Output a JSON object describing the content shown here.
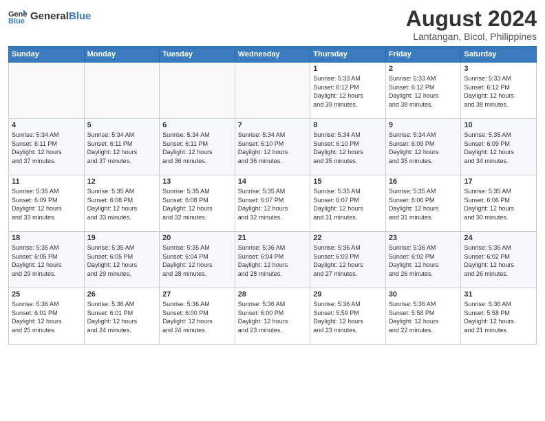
{
  "header": {
    "logo_general": "General",
    "logo_blue": "Blue",
    "title": "August 2024",
    "subtitle": "Lantangan, Bicol, Philippines"
  },
  "days_of_week": [
    "Sunday",
    "Monday",
    "Tuesday",
    "Wednesday",
    "Thursday",
    "Friday",
    "Saturday"
  ],
  "weeks": [
    [
      {
        "day": "",
        "info": ""
      },
      {
        "day": "",
        "info": ""
      },
      {
        "day": "",
        "info": ""
      },
      {
        "day": "",
        "info": ""
      },
      {
        "day": "1",
        "info": "Sunrise: 5:33 AM\nSunset: 6:12 PM\nDaylight: 12 hours\nand 39 minutes."
      },
      {
        "day": "2",
        "info": "Sunrise: 5:33 AM\nSunset: 6:12 PM\nDaylight: 12 hours\nand 38 minutes."
      },
      {
        "day": "3",
        "info": "Sunrise: 5:33 AM\nSunset: 6:12 PM\nDaylight: 12 hours\nand 38 minutes."
      }
    ],
    [
      {
        "day": "4",
        "info": "Sunrise: 5:34 AM\nSunset: 6:11 PM\nDaylight: 12 hours\nand 37 minutes."
      },
      {
        "day": "5",
        "info": "Sunrise: 5:34 AM\nSunset: 6:11 PM\nDaylight: 12 hours\nand 37 minutes."
      },
      {
        "day": "6",
        "info": "Sunrise: 5:34 AM\nSunset: 6:11 PM\nDaylight: 12 hours\nand 36 minutes."
      },
      {
        "day": "7",
        "info": "Sunrise: 5:34 AM\nSunset: 6:10 PM\nDaylight: 12 hours\nand 36 minutes."
      },
      {
        "day": "8",
        "info": "Sunrise: 5:34 AM\nSunset: 6:10 PM\nDaylight: 12 hours\nand 35 minutes."
      },
      {
        "day": "9",
        "info": "Sunrise: 5:34 AM\nSunset: 6:09 PM\nDaylight: 12 hours\nand 35 minutes."
      },
      {
        "day": "10",
        "info": "Sunrise: 5:35 AM\nSunset: 6:09 PM\nDaylight: 12 hours\nand 34 minutes."
      }
    ],
    [
      {
        "day": "11",
        "info": "Sunrise: 5:35 AM\nSunset: 6:09 PM\nDaylight: 12 hours\nand 33 minutes."
      },
      {
        "day": "12",
        "info": "Sunrise: 5:35 AM\nSunset: 6:08 PM\nDaylight: 12 hours\nand 33 minutes."
      },
      {
        "day": "13",
        "info": "Sunrise: 5:35 AM\nSunset: 6:08 PM\nDaylight: 12 hours\nand 32 minutes."
      },
      {
        "day": "14",
        "info": "Sunrise: 5:35 AM\nSunset: 6:07 PM\nDaylight: 12 hours\nand 32 minutes."
      },
      {
        "day": "15",
        "info": "Sunrise: 5:35 AM\nSunset: 6:07 PM\nDaylight: 12 hours\nand 31 minutes."
      },
      {
        "day": "16",
        "info": "Sunrise: 5:35 AM\nSunset: 6:06 PM\nDaylight: 12 hours\nand 31 minutes."
      },
      {
        "day": "17",
        "info": "Sunrise: 5:35 AM\nSunset: 6:06 PM\nDaylight: 12 hours\nand 30 minutes."
      }
    ],
    [
      {
        "day": "18",
        "info": "Sunrise: 5:35 AM\nSunset: 6:05 PM\nDaylight: 12 hours\nand 29 minutes."
      },
      {
        "day": "19",
        "info": "Sunrise: 5:35 AM\nSunset: 6:05 PM\nDaylight: 12 hours\nand 29 minutes."
      },
      {
        "day": "20",
        "info": "Sunrise: 5:35 AM\nSunset: 6:04 PM\nDaylight: 12 hours\nand 28 minutes."
      },
      {
        "day": "21",
        "info": "Sunrise: 5:36 AM\nSunset: 6:04 PM\nDaylight: 12 hours\nand 28 minutes."
      },
      {
        "day": "22",
        "info": "Sunrise: 5:36 AM\nSunset: 6:03 PM\nDaylight: 12 hours\nand 27 minutes."
      },
      {
        "day": "23",
        "info": "Sunrise: 5:36 AM\nSunset: 6:02 PM\nDaylight: 12 hours\nand 26 minutes."
      },
      {
        "day": "24",
        "info": "Sunrise: 5:36 AM\nSunset: 6:02 PM\nDaylight: 12 hours\nand 26 minutes."
      }
    ],
    [
      {
        "day": "25",
        "info": "Sunrise: 5:36 AM\nSunset: 6:01 PM\nDaylight: 12 hours\nand 25 minutes."
      },
      {
        "day": "26",
        "info": "Sunrise: 5:36 AM\nSunset: 6:01 PM\nDaylight: 12 hours\nand 24 minutes."
      },
      {
        "day": "27",
        "info": "Sunrise: 5:36 AM\nSunset: 6:00 PM\nDaylight: 12 hours\nand 24 minutes."
      },
      {
        "day": "28",
        "info": "Sunrise: 5:36 AM\nSunset: 6:00 PM\nDaylight: 12 hours\nand 23 minutes."
      },
      {
        "day": "29",
        "info": "Sunrise: 5:36 AM\nSunset: 5:59 PM\nDaylight: 12 hours\nand 23 minutes."
      },
      {
        "day": "30",
        "info": "Sunrise: 5:36 AM\nSunset: 5:58 PM\nDaylight: 12 hours\nand 22 minutes."
      },
      {
        "day": "31",
        "info": "Sunrise: 5:36 AM\nSunset: 5:58 PM\nDaylight: 12 hours\nand 21 minutes."
      }
    ]
  ]
}
